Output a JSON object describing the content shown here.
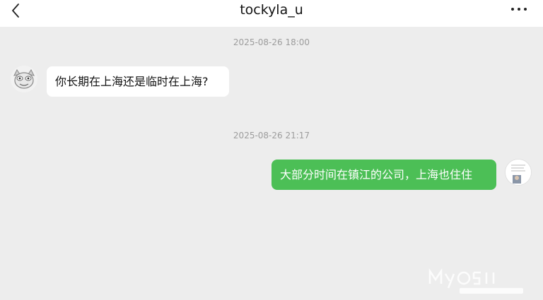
{
  "header": {
    "title": "tockyla_u",
    "back_icon": "chevron-left-icon",
    "more_icon": "more-dots-icon"
  },
  "messages": [
    {
      "timestamp": "2025-08-26 18:00",
      "side": "left",
      "text": "你长期在上海还是临时在上海?"
    },
    {
      "timestamp": "2025-08-26 21:17",
      "side": "right",
      "text": "大部分时间在镇江的公司，上海也住住"
    }
  ],
  "colors": {
    "background": "#ededed",
    "outgoing_bubble": "#4cbf56",
    "incoming_bubble": "#ffffff"
  }
}
